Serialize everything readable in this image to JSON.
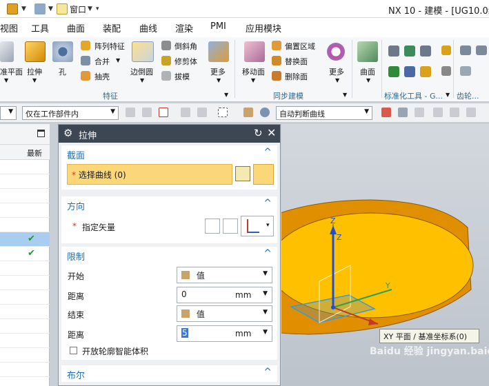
{
  "menubar": {
    "items": [
      "视图",
      "工具",
      "曲面",
      "装配",
      "曲线",
      "渲染",
      "PMI",
      "应用模块"
    ]
  },
  "titlebar": {
    "window_menu": "窗口",
    "app_title": "NX 10 - 建模 - [UG10.0练习"
  },
  "ribbon": {
    "feature_tools": {
      "datum_plane": "准平面",
      "extrude": "拉伸",
      "hole": "孔",
      "pattern_feature": "阵列特征",
      "unite": "合并",
      "shell": "抽壳",
      "edge_blend": "边倒圆",
      "chamfer": "倒斜角",
      "trim_body": "修剪体",
      "draft": "拔模",
      "more": "更多"
    },
    "sync_tools": {
      "move_face": "移动面",
      "offset_region": "偏置区域",
      "replace_face": "替换面",
      "delete_face": "删除面",
      "more": "更多"
    },
    "surface_tools": {
      "surface": "曲面"
    },
    "groups": {
      "feature": "特征",
      "sync": "同步建模",
      "standard_tools": "标准化工具 - G...",
      "gear": "齿轮..."
    }
  },
  "toolbar2": {
    "scope_filter": "仅在工作部件内",
    "curve_rule": "自动判断曲线"
  },
  "navigator": {
    "column_latest": "最新",
    "rows": [
      {
        "selected": false,
        "latest": false
      },
      {
        "selected": false,
        "latest": false
      },
      {
        "selected": false,
        "latest": false
      },
      {
        "selected": false,
        "latest": false
      },
      {
        "selected": false,
        "latest": false
      },
      {
        "selected": true,
        "latest": true
      },
      {
        "selected": false,
        "latest": true
      },
      {
        "selected": false,
        "latest": false
      },
      {
        "selected": false,
        "latest": false
      },
      {
        "selected": false,
        "latest": false
      },
      {
        "selected": false,
        "latest": false
      },
      {
        "selected": false,
        "latest": false
      },
      {
        "selected": false,
        "latest": false
      },
      {
        "selected": false,
        "latest": false
      },
      {
        "selected": false,
        "latest": false
      }
    ],
    "check_glyph": "✔"
  },
  "dialog": {
    "title": "拉伸",
    "section": {
      "title": "截面",
      "required_mark": "*",
      "select_curve": "选择曲线 (0)"
    },
    "direction": {
      "title": "方向",
      "required_mark": "*",
      "specify_vector": "指定矢量"
    },
    "limits": {
      "title": "限制",
      "start_label": "开始",
      "start_value": "值",
      "distance_label": "距离",
      "start_distance": "0",
      "unit": "mm",
      "end_label": "结束",
      "end_value": "值",
      "end_distance_label": "距离",
      "end_distance": "5",
      "end_unit": "mm",
      "open_profile": "开放轮廓智能体积"
    },
    "boolean": {
      "title": "布尔"
    }
  },
  "viewport": {
    "axis_z": "Z",
    "axis_y": "Y",
    "tooltip": "XY 平面 / 基准坐标系(0)"
  },
  "colors": {
    "accent": "#1d6fb5",
    "highlight_field": "#fbd779",
    "cylinder_top": "#ffc000",
    "cylinder_side": "#d58b00"
  },
  "watermark": "Baidu 经验 jingyan.baidu.com"
}
